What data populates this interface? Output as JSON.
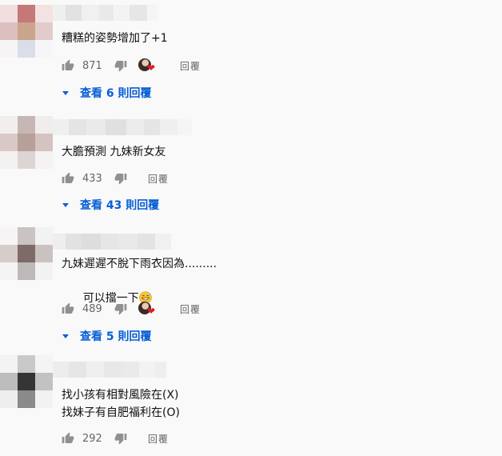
{
  "comments": [
    {
      "text": "糟糕的姿勢增加了+1",
      "likes": "871",
      "has_creator_heart": true,
      "reply_label": "回覆",
      "view_replies": "查看 6 則回覆"
    },
    {
      "text": "大膽預測 九妹新女友",
      "likes": "433",
      "has_creator_heart": false,
      "reply_label": "回覆",
      "view_replies": "查看 43 則回覆"
    },
    {
      "text_line1": "九妹遲遲不脫下雨衣因為.........",
      "text_line2": "可以擋一下",
      "emoji": "grinning-sweat-emoji",
      "likes": "489",
      "has_creator_heart": true,
      "reply_label": "回覆",
      "view_replies": "查看 5 則回覆"
    },
    {
      "text_line1": "找小孩有相對風險在(X)",
      "text_line2": "找妹子有自肥福利在(O)",
      "likes": "292",
      "has_creator_heart": false,
      "reply_label": "回覆"
    }
  ],
  "icons": {
    "like": "thumb-up-icon",
    "dislike": "thumb-down-icon",
    "expand": "caret-down-icon",
    "heart": "creator-heart-icon"
  },
  "colors": {
    "background": "#f9f9f9",
    "link_blue": "#065fd4",
    "icon_gray": "#909090",
    "heart_red": "#e31b23"
  }
}
